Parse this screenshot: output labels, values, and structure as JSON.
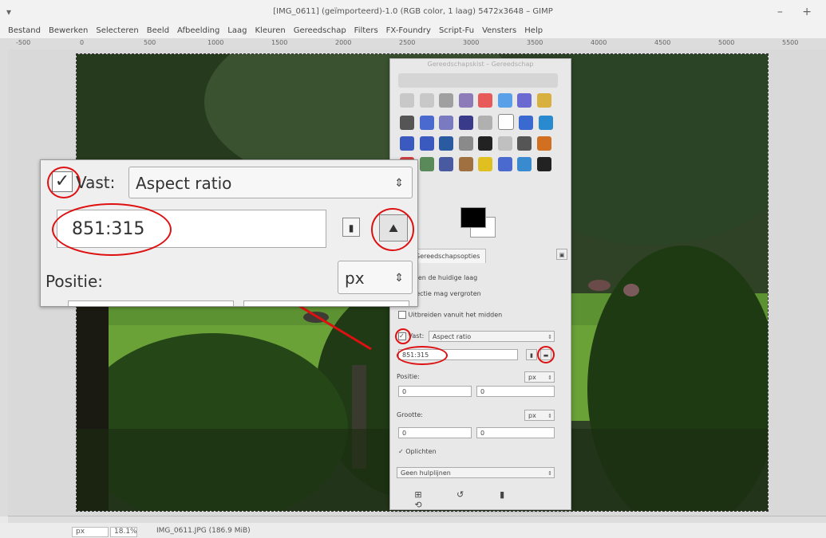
{
  "window": {
    "title": "[IMG_0611] (geïmporteerd)-1.0 (RGB color, 1 laag) 5472x3648 – GIMP",
    "left_glyph": "▾",
    "controls": "– +"
  },
  "menu": [
    "Bestand",
    "Bewerken",
    "Selecteren",
    "Beeld",
    "Afbeelding",
    "Laag",
    "Kleuren",
    "Gereedschap",
    "Filters",
    "FX-Foundry",
    "Script-Fu",
    "Vensters",
    "Help"
  ],
  "ruler": [
    "-500",
    "0",
    "500",
    "1000",
    "1500",
    "2000",
    "2500",
    "3000",
    "3500",
    "4000",
    "4500",
    "5000",
    "5500"
  ],
  "statusbar": {
    "unit": "px",
    "zoom": "18.1%",
    "file": "IMG_0611.JPG (186.9 MiB)"
  },
  "toolbox": {
    "title": "Gereedschapskist – Gereedschap",
    "tab_label": "Gereedschapsopties",
    "opt1": "Alleen de huidige laag",
    "opt2": "Selectie mag vergroten",
    "expand_label": "Uitbreiden vanuit het midden",
    "fixed_label": "Vast:",
    "fixed_value": "Aspect ratio",
    "ratio": "851:315",
    "position_label": "Positie:",
    "size_label": "Grootte:",
    "unit": "px",
    "pos_x": "0",
    "pos_y": "0",
    "size_x": "0",
    "size_y": "0",
    "highlight_label": "Oplichten",
    "guides_value": "Geen hulplijnen"
  },
  "callout": {
    "fixed_label": "Vast:",
    "fixed_value": "Aspect ratio",
    "ratio": "851:315",
    "position_label": "Positie:",
    "unit": "px"
  },
  "colors": {
    "annotation": "#d11111",
    "grass": "#6aa238",
    "tree_dark": "#1f2e16"
  }
}
